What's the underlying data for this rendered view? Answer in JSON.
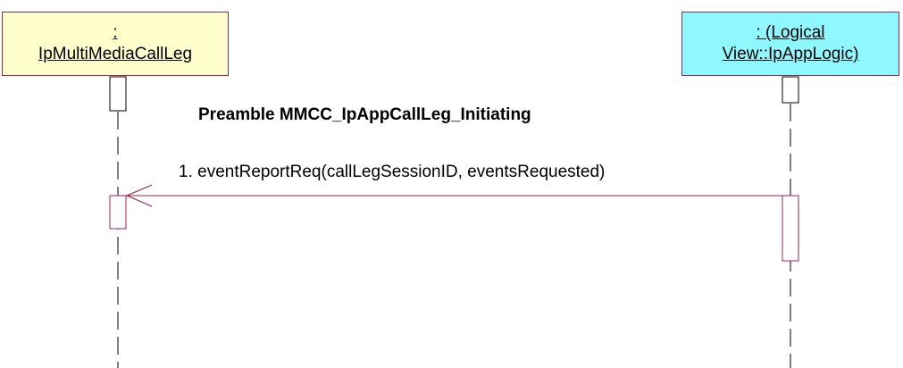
{
  "lifelines": [
    {
      "line1": ":",
      "line2": "IpMultiMediaCallLeg",
      "fill": "#ffffcc"
    },
    {
      "line1": ": (Logical",
      "line2": "View::IpAppLogic)",
      "fill": "#8ff8ff"
    }
  ],
  "diagram": {
    "title": "Preamble MMCC_IpAppCallLeg_Initiating",
    "message": "1. eventReportReq(callLegSessionID, eventsRequested)",
    "line_color": "#9a2a4a"
  }
}
